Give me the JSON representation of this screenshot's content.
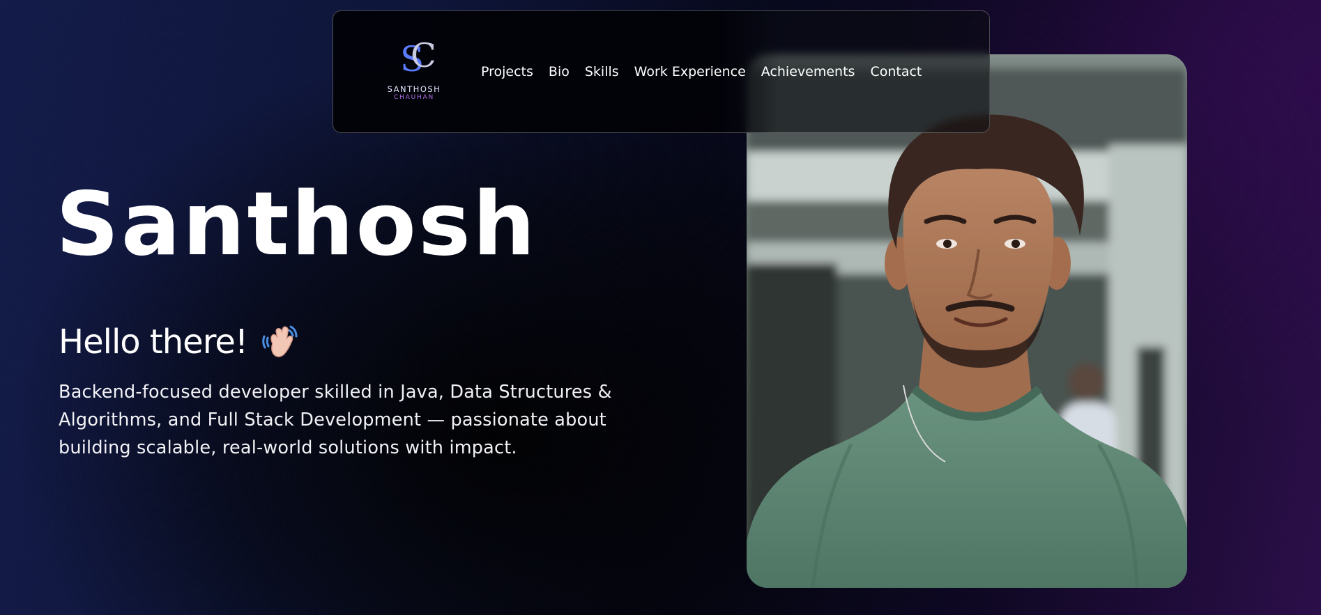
{
  "logo": {
    "monogram_s": "S",
    "monogram_c": "C",
    "name": "SANTHOSH",
    "surname": "CHAUHAN",
    "colors": {
      "s": "#5b7cff",
      "c": "#c8cbe0",
      "surname": "#b070e8"
    }
  },
  "nav": {
    "items": [
      {
        "label": "Projects"
      },
      {
        "label": "Bio"
      },
      {
        "label": "Skills"
      },
      {
        "label": "Work Experience"
      },
      {
        "label": "Achievements"
      },
      {
        "label": "Contact"
      }
    ]
  },
  "hero": {
    "name": "Santhosh",
    "greeting": "Hello there!",
    "greeting_icon": "waving-hand-icon",
    "bio": "Backend-focused developer skilled in Java, Data Structures & Algorithms, and Full Stack Development — passionate about building scalable, real-world solutions with impact."
  },
  "portrait": {
    "icon": "profile-photo",
    "shirt_color": "#5e8a76"
  },
  "theme": {
    "background_left": "#121a48",
    "background_right": "#2a0d48",
    "text": "#ffffff"
  }
}
